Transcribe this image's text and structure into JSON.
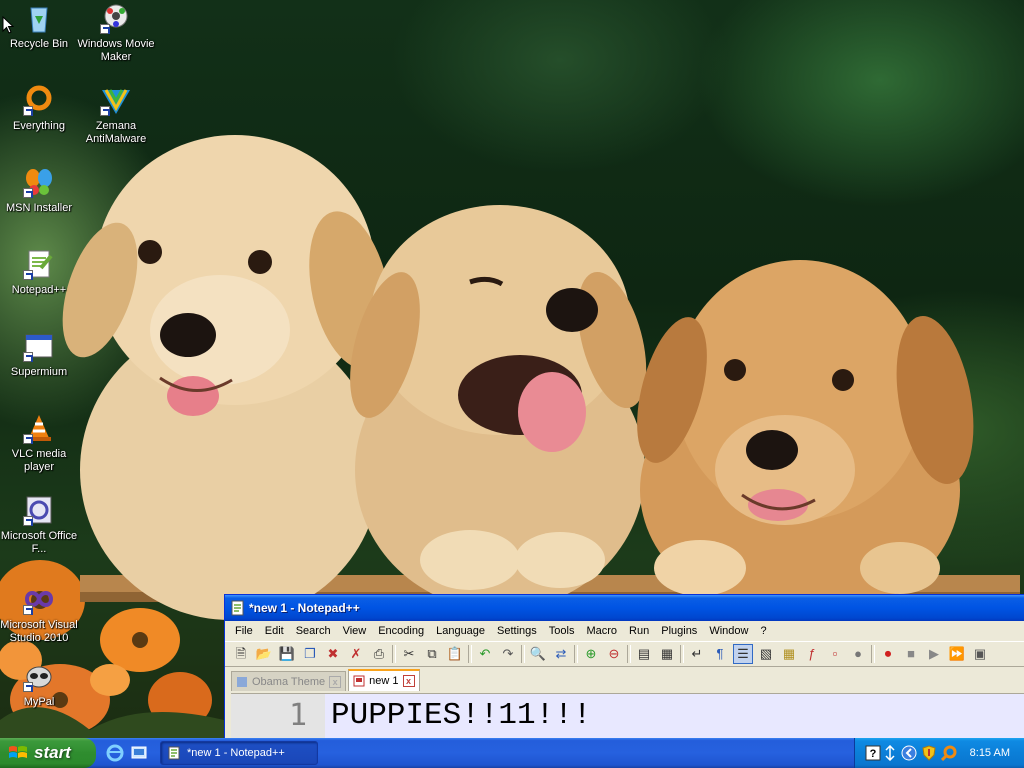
{
  "desktop": {
    "icons": [
      {
        "label": "Recycle Bin"
      },
      {
        "label": "Windows Movie Maker"
      },
      {
        "label": "Everything"
      },
      {
        "label": "Zemana AntiMalware"
      },
      {
        "label": "MSN Installer"
      },
      {
        "label": "Notepad++"
      },
      {
        "label": "Supermium"
      },
      {
        "label": "VLC media player"
      },
      {
        "label": "Microsoft Office F..."
      },
      {
        "label": "Microsoft Visual Studio 2010"
      },
      {
        "label": "MyPal"
      }
    ]
  },
  "window": {
    "title": "*new 1 - Notepad++",
    "menu": [
      "File",
      "Edit",
      "Search",
      "View",
      "Encoding",
      "Language",
      "Settings",
      "Tools",
      "Macro",
      "Run",
      "Plugins",
      "Window",
      "?"
    ],
    "tabs": [
      {
        "label": "Obama Theme",
        "active": false
      },
      {
        "label": "new 1",
        "active": true
      }
    ],
    "editor": {
      "line_number": "1",
      "line_text": "PUPPIES!!11!!!"
    }
  },
  "taskbar": {
    "start_label": "start",
    "task_label": "*new 1 - Notepad++",
    "clock": "8:15 AM"
  },
  "colors": {
    "taskbar_blue": "#245edb",
    "start_green": "#3c9a3c",
    "titlebar_blue": "#0054e3",
    "active_tab_accent": "#f9a31c"
  }
}
